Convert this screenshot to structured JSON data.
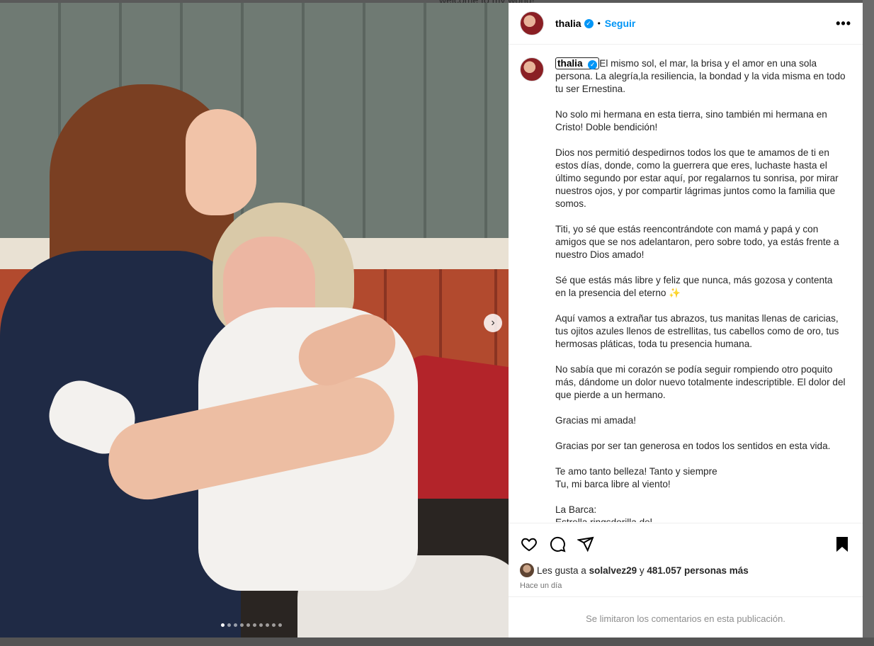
{
  "backdrop": {
    "top_text": "welcome to my world!"
  },
  "post": {
    "username": "thalia",
    "follow_label": "Seguir",
    "separator": "•",
    "more_label": "•••",
    "caption": [
      "El mismo sol, el mar, la brisa y el amor en una sola persona. La alegría,la resiliencia, la bondad y la vida misma en todo tu ser Ernestina.",
      "No solo mi hermana en esta tierra, sino también mi hermana en Cristo! Doble bendición!",
      "Dios nos permitió despedirnos todos los que te amamos de ti en estos días, donde, como la guerrera que eres, luchaste hasta el último segundo por estar aquí, por regalarnos tu sonrisa, por mirar nuestros ojos, y por compartir lágrimas juntos como la familia que somos.",
      "Titi, yo sé que estás reencontrándote con mamá y papá y con amigos que se nos adelantaron, pero sobre todo, ya estás frente a nuestro Dios amado!",
      "Sé que estás más libre y feliz que nunca, más gozosa y contenta en la presencia del eterno ✨",
      "Aquí vamos a extrañar tus abrazos, tus manitas llenas de caricias, tus ojitos azules llenos de estrellitas, tus cabellos como de oro, tus hermosas pláticas, toda tu presencia humana.",
      "No sabía que mi corazón se podía seguir rompiendo otro poquito más, dándome un dolor nuevo totalmente indescriptible. El dolor del que pierde a un hermano.",
      "Gracias mi amada!",
      "Gracias por ser tan generosa en todos los sentidos en esta vida.",
      "Te amo tanto belleza! Tanto y siempre\nTu, mi barca libre al viento!",
      "La Barca:\nEstrella ringsdorilla del..."
    ],
    "likes_prefix": "Les gusta a",
    "likes_user": "solalvez29",
    "likes_join": "y",
    "likes_count": "481.057 personas más",
    "time_ago": "Hace un día",
    "comments_disabled": "Se limitaron los comentarios en esta publicación.",
    "carousel": {
      "count": 10,
      "active": 0
    }
  },
  "icons": {
    "like": "heart-icon",
    "comment": "comment-icon",
    "share": "share-icon",
    "save": "bookmark-icon",
    "next": "chevron-right-icon",
    "verified": "verified-badge-icon"
  },
  "colors": {
    "accent": "#0095f6",
    "muted": "#737373"
  }
}
